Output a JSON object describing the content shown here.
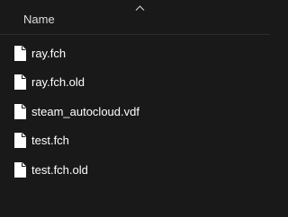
{
  "header": {
    "name_column": "Name",
    "sort_direction": "ascending"
  },
  "files": [
    {
      "name": "ray.fch",
      "icon": "file-icon"
    },
    {
      "name": "ray.fch.old",
      "icon": "file-icon"
    },
    {
      "name": "steam_autocloud.vdf",
      "icon": "file-icon"
    },
    {
      "name": "test.fch",
      "icon": "file-icon"
    },
    {
      "name": "test.fch.old",
      "icon": "file-icon"
    }
  ],
  "colors": {
    "background": "#191919",
    "text": "#ffffff",
    "header_text": "#dedede",
    "icon_fill": "#ffffff"
  }
}
